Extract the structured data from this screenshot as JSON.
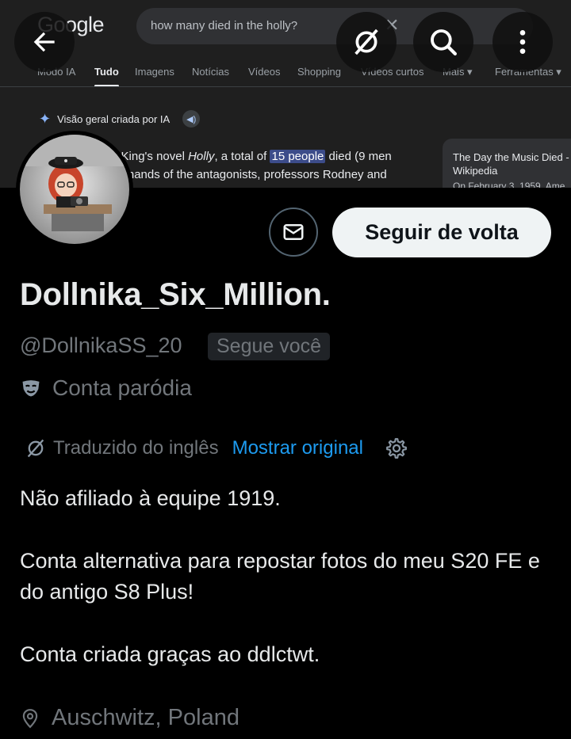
{
  "banner": {
    "logo_text": "Google",
    "search_query": "how many died in the holly?",
    "clear_icon": "close-icon",
    "tabs": [
      "Modo IA",
      "Tudo",
      "Imagens",
      "Notícias",
      "Vídeos",
      "Shopping",
      "Vídeos curtos",
      "Mais ▾",
      "Ferramentas ▾"
    ],
    "active_tab": "Tudo",
    "ai_overview_label": "Visão geral criada por IA",
    "ai_text_part1": "n King's novel ",
    "ai_text_italic": "Holly",
    "ai_text_part2": ", a total of ",
    "ai_text_highlight": "15 people",
    "ai_text_part3": " died (9 men",
    "ai_text_line2": "he hands of the antagonists, professors Rodney and",
    "side_card_title": "The Day the Music Died - Wikipedia",
    "side_card_snippet": "On February 3, 1959, Ame"
  },
  "overlay": {
    "back_icon": "arrow-left-icon",
    "grok_icon": "grok-icon",
    "search_icon": "search-icon",
    "more_icon": "more-vertical-icon"
  },
  "profile": {
    "dm_icon": "envelope-icon",
    "follow_back_label": "Seguir de volta",
    "display_name": "Dollnika_Six_Million.",
    "handle": "@DollnikaSS_20",
    "follows_you_badge": "Segue você",
    "parody_label": "Conta paródia",
    "parody_icon": "mask-icon",
    "translation": {
      "label": "Traduzido do inglês",
      "show_original": "Mostrar original",
      "settings_icon": "gear-icon"
    },
    "bio": [
      "Não afiliado à equipe 1919.",
      "Conta alternativa para repostar fotos do meu S20 FE e do antigo S8 Plus!",
      "Conta criada graças ao ddlctwt."
    ],
    "location_icon": "location-pin-icon",
    "location": "Auschwitz, Poland"
  },
  "colors": {
    "background": "#000000",
    "text_primary": "#e7e9ea",
    "text_secondary": "#71767b",
    "link_blue": "#1d9bf0",
    "button_light": "#eff3f4",
    "badge_bg": "#202327"
  }
}
